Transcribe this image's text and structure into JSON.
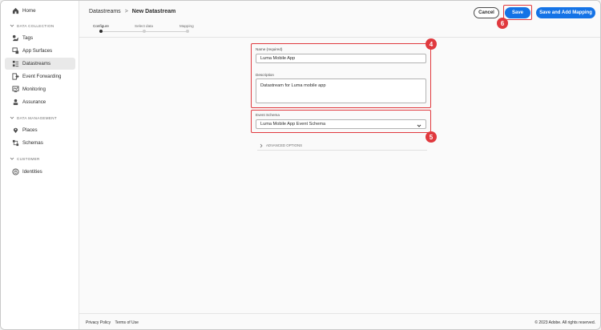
{
  "sidebar": {
    "home": "Home",
    "sections": [
      {
        "title": "DATA COLLECTION"
      },
      {
        "title": "DATA MANAGEMENT"
      },
      {
        "title": "CUSTOMER"
      }
    ],
    "items": [
      {
        "label": "Tags",
        "icon": "tags-icon"
      },
      {
        "label": "App Surfaces",
        "icon": "app-surfaces-icon"
      },
      {
        "label": "Datastreams",
        "icon": "datastreams-icon",
        "active": true
      },
      {
        "label": "Event Forwarding",
        "icon": "event-forwarding-icon"
      },
      {
        "label": "Monitoring",
        "icon": "monitoring-icon"
      },
      {
        "label": "Assurance",
        "icon": "assurance-icon"
      },
      {
        "label": "Places",
        "icon": "places-icon"
      },
      {
        "label": "Schemas",
        "icon": "schemas-icon"
      },
      {
        "label": "Identities",
        "icon": "identities-icon"
      }
    ]
  },
  "header": {
    "breadcrumb_parent": "Datastreams",
    "breadcrumb_separator": ">",
    "breadcrumb_current": "New Datastream",
    "cancel_label": "Cancel",
    "save_label": "Save",
    "save_map_label": "Save and Add Mapping"
  },
  "steps": [
    {
      "label": "Configure",
      "active": true
    },
    {
      "label": "Select data",
      "active": false
    },
    {
      "label": "Mapping",
      "active": false
    }
  ],
  "form": {
    "name_label": "Name (required)",
    "name_value": "Luma Mobile App",
    "description_label": "Description",
    "description_value": "Datastream for Luma mobile app",
    "schema_label": "Event Schema",
    "schema_value": "Luma Mobile App Event Schema",
    "advanced_label": "ADVANCED OPTIONS"
  },
  "annotations": {
    "badge_4": "4",
    "badge_5": "5",
    "badge_6": "6"
  },
  "footer": {
    "privacy": "Privacy Policy",
    "terms": "Terms of Use",
    "copyright": "© 2023 Adobe. All rights reserved."
  },
  "colors": {
    "accent": "#1473e6",
    "highlight": "#e0393e"
  }
}
